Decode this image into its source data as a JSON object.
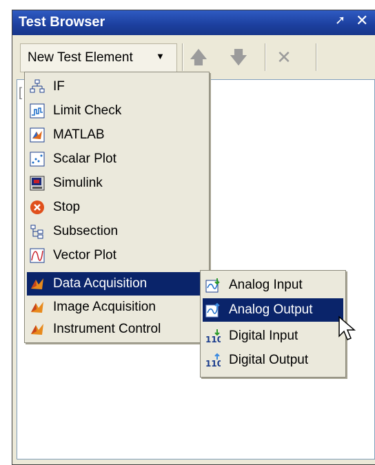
{
  "window": {
    "title": "Test Browser"
  },
  "toolbar": {
    "new_test_element_label": "New Test Element",
    "buttons": [
      {
        "icon": "move-up-arrow-icon"
      },
      {
        "icon": "move-down-arrow-icon"
      },
      {
        "icon": "delete-x-icon"
      }
    ]
  },
  "menu": {
    "items": [
      {
        "label": "IF",
        "icon": "if-flowchart-icon"
      },
      {
        "label": "Limit Check",
        "icon": "limit-check-icon"
      },
      {
        "label": "MATLAB",
        "icon": "matlab-icon"
      },
      {
        "label": "Scalar Plot",
        "icon": "scalar-plot-icon"
      },
      {
        "label": "Simulink",
        "icon": "simulink-icon"
      },
      {
        "label": "Stop",
        "icon": "stop-icon"
      },
      {
        "label": "Subsection",
        "icon": "subsection-icon"
      },
      {
        "label": "Vector Plot",
        "icon": "vector-plot-icon"
      },
      {
        "label": "Data Acquisition",
        "icon": "matlab-membrane-icon",
        "submenu": true,
        "highlighted": true
      },
      {
        "label": "Image Acquisition",
        "icon": "matlab-membrane-icon",
        "submenu": true
      },
      {
        "label": "Instrument Control",
        "icon": "matlab-membrane-icon",
        "submenu": true
      }
    ]
  },
  "submenu": {
    "items": [
      {
        "label": "Analog Input",
        "icon": "analog-input-icon"
      },
      {
        "label": "Analog Output",
        "icon": "analog-output-icon",
        "highlighted": true
      },
      {
        "label": "Digital Input",
        "icon": "digital-input-icon"
      },
      {
        "label": "Digital Output",
        "icon": "digital-output-icon"
      }
    ]
  }
}
